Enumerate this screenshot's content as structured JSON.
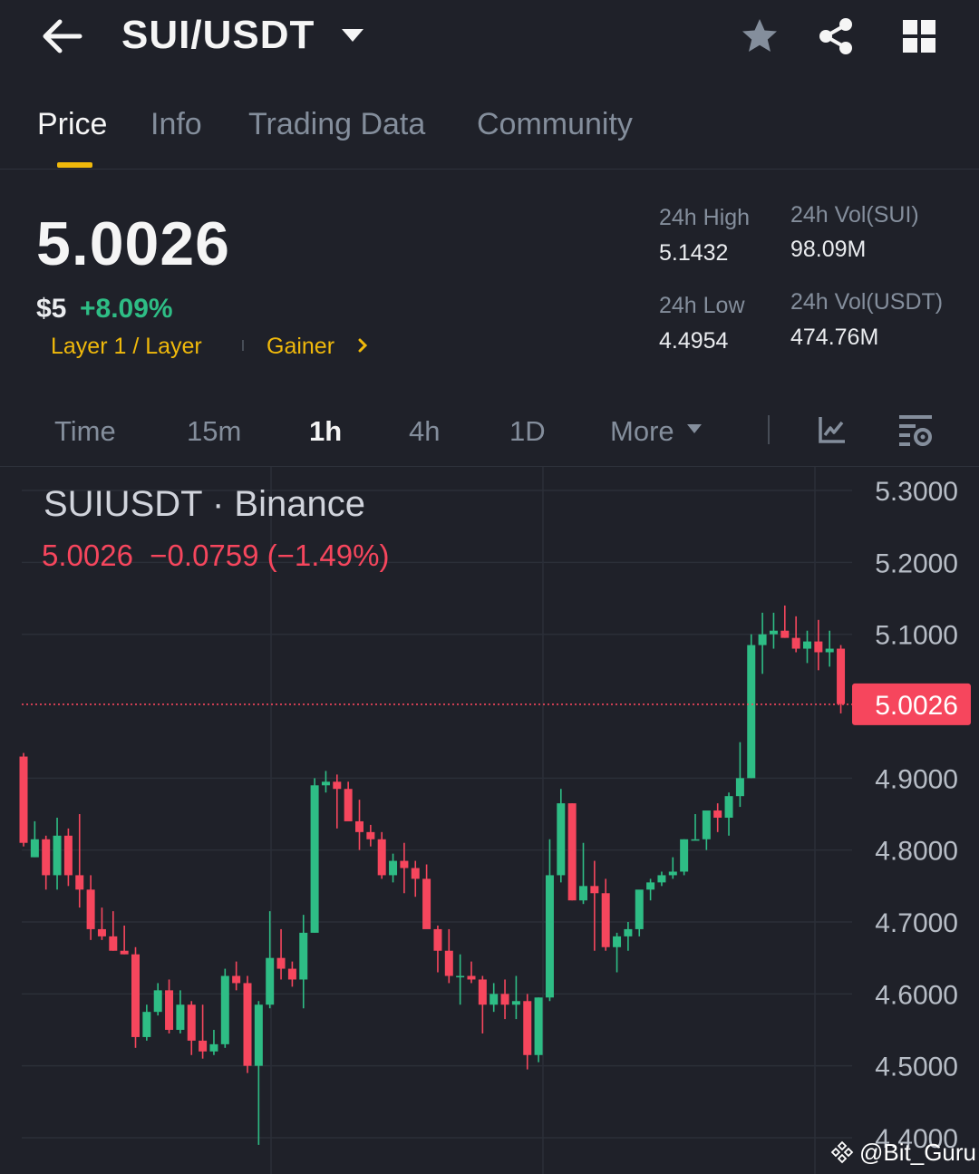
{
  "header": {
    "pair": "SUI/USDT",
    "icons": [
      "back-arrow-icon",
      "caret-down-icon",
      "star-icon",
      "share-icon",
      "grid-icon"
    ]
  },
  "tabs": [
    {
      "label": "Price",
      "active": true
    },
    {
      "label": "Info",
      "active": false
    },
    {
      "label": "Trading Data",
      "active": false
    },
    {
      "label": "Community",
      "active": false
    }
  ],
  "ticker": {
    "last_price": "5.0026",
    "usd_price": "$5",
    "change_pct": "+8.09%",
    "tag_category": "Layer 1 / Layer",
    "tag_gainer": "Gainer",
    "high_label": "24h High",
    "high_value": "5.1432",
    "low_label": "24h Low",
    "low_value": "4.4954",
    "vol_base_label": "24h Vol(SUI)",
    "vol_base_value": "98.09M",
    "vol_quote_label": "24h Vol(USDT)",
    "vol_quote_value": "474.76M"
  },
  "intervals": {
    "items": [
      "Time",
      "15m",
      "1h",
      "4h",
      "1D",
      "More"
    ],
    "selected": "1h"
  },
  "colors": {
    "up": "#2ebd85",
    "down": "#f6465d",
    "accent": "#f0b90b",
    "background": "#1f2129"
  },
  "chart_data": {
    "type": "candlestick",
    "symbol_title": "SUIUSDT · Binance",
    "ohlc_summary": "5.0026  −0.0759 (−1.49%)",
    "current_price_label": "5.0026",
    "current_price": 5.0026,
    "y_ticks": [
      "5.3000",
      "5.2000",
      "5.1000",
      "4.9000",
      "4.8000",
      "4.7000",
      "4.6000",
      "4.5000",
      "4.4000"
    ],
    "ylim": [
      4.37,
      5.305
    ],
    "grid": true,
    "candles": [
      {
        "o": 4.93,
        "h": 4.935,
        "l": 4.805,
        "c": 4.81
      },
      {
        "o": 4.79,
        "h": 4.84,
        "l": 4.79,
        "c": 4.815
      },
      {
        "o": 4.815,
        "h": 4.82,
        "l": 4.745,
        "c": 4.765
      },
      {
        "o": 4.765,
        "h": 4.845,
        "l": 4.745,
        "c": 4.82
      },
      {
        "o": 4.82,
        "h": 4.83,
        "l": 4.75,
        "c": 4.765
      },
      {
        "o": 4.765,
        "h": 4.85,
        "l": 4.72,
        "c": 4.745
      },
      {
        "o": 4.745,
        "h": 4.765,
        "l": 4.675,
        "c": 4.69
      },
      {
        "o": 4.69,
        "h": 4.72,
        "l": 4.675,
        "c": 4.68
      },
      {
        "o": 4.68,
        "h": 4.715,
        "l": 4.66,
        "c": 4.66
      },
      {
        "o": 4.66,
        "h": 4.695,
        "l": 4.655,
        "c": 4.655
      },
      {
        "o": 4.655,
        "h": 4.665,
        "l": 4.525,
        "c": 4.54
      },
      {
        "o": 4.54,
        "h": 4.585,
        "l": 4.535,
        "c": 4.575
      },
      {
        "o": 4.575,
        "h": 4.615,
        "l": 4.57,
        "c": 4.605
      },
      {
        "o": 4.605,
        "h": 4.62,
        "l": 4.545,
        "c": 4.55
      },
      {
        "o": 4.55,
        "h": 4.605,
        "l": 4.545,
        "c": 4.585
      },
      {
        "o": 4.585,
        "h": 4.59,
        "l": 4.515,
        "c": 4.535
      },
      {
        "o": 4.535,
        "h": 4.585,
        "l": 4.51,
        "c": 4.52
      },
      {
        "o": 4.52,
        "h": 4.55,
        "l": 4.515,
        "c": 4.53
      },
      {
        "o": 4.53,
        "h": 4.635,
        "l": 4.525,
        "c": 4.625
      },
      {
        "o": 4.625,
        "h": 4.645,
        "l": 4.605,
        "c": 4.615
      },
      {
        "o": 4.615,
        "h": 4.625,
        "l": 4.49,
        "c": 4.5
      },
      {
        "o": 4.5,
        "h": 4.59,
        "l": 4.39,
        "c": 4.585
      },
      {
        "o": 4.585,
        "h": 4.715,
        "l": 4.58,
        "c": 4.65
      },
      {
        "o": 4.65,
        "h": 4.69,
        "l": 4.62,
        "c": 4.635
      },
      {
        "o": 4.635,
        "h": 4.645,
        "l": 4.61,
        "c": 4.62
      },
      {
        "o": 4.62,
        "h": 4.71,
        "l": 4.58,
        "c": 4.685
      },
      {
        "o": 4.685,
        "h": 4.9,
        "l": 4.685,
        "c": 4.89
      },
      {
        "o": 4.89,
        "h": 4.91,
        "l": 4.88,
        "c": 4.895
      },
      {
        "o": 4.895,
        "h": 4.905,
        "l": 4.83,
        "c": 4.885
      },
      {
        "o": 4.885,
        "h": 4.895,
        "l": 4.85,
        "c": 4.84
      },
      {
        "o": 4.84,
        "h": 4.87,
        "l": 4.8,
        "c": 4.825
      },
      {
        "o": 4.825,
        "h": 4.835,
        "l": 4.805,
        "c": 4.815
      },
      {
        "o": 4.815,
        "h": 4.825,
        "l": 4.76,
        "c": 4.765
      },
      {
        "o": 4.765,
        "h": 4.795,
        "l": 4.755,
        "c": 4.785
      },
      {
        "o": 4.785,
        "h": 4.81,
        "l": 4.74,
        "c": 4.775
      },
      {
        "o": 4.775,
        "h": 4.785,
        "l": 4.735,
        "c": 4.76
      },
      {
        "o": 4.76,
        "h": 4.78,
        "l": 4.7,
        "c": 4.69
      },
      {
        "o": 4.69,
        "h": 4.695,
        "l": 4.63,
        "c": 4.66
      },
      {
        "o": 4.66,
        "h": 4.69,
        "l": 4.615,
        "c": 4.625
      },
      {
        "o": 4.625,
        "h": 4.655,
        "l": 4.585,
        "c": 4.625
      },
      {
        "o": 4.625,
        "h": 4.645,
        "l": 4.615,
        "c": 4.62
      },
      {
        "o": 4.62,
        "h": 4.625,
        "l": 4.545,
        "c": 4.585
      },
      {
        "o": 4.585,
        "h": 4.615,
        "l": 4.575,
        "c": 4.6
      },
      {
        "o": 4.6,
        "h": 4.62,
        "l": 4.565,
        "c": 4.585
      },
      {
        "o": 4.585,
        "h": 4.625,
        "l": 4.565,
        "c": 4.59
      },
      {
        "o": 4.59,
        "h": 4.6,
        "l": 4.495,
        "c": 4.515
      },
      {
        "o": 4.515,
        "h": 4.595,
        "l": 4.505,
        "c": 4.595
      },
      {
        "o": 4.595,
        "h": 4.815,
        "l": 4.59,
        "c": 4.765
      },
      {
        "o": 4.765,
        "h": 4.885,
        "l": 4.755,
        "c": 4.865
      },
      {
        "o": 4.865,
        "h": 4.865,
        "l": 4.73,
        "c": 4.73
      },
      {
        "o": 4.73,
        "h": 4.81,
        "l": 4.725,
        "c": 4.75
      },
      {
        "o": 4.75,
        "h": 4.785,
        "l": 4.66,
        "c": 4.74
      },
      {
        "o": 4.74,
        "h": 4.76,
        "l": 4.66,
        "c": 4.665
      },
      {
        "o": 4.665,
        "h": 4.685,
        "l": 4.63,
        "c": 4.68
      },
      {
        "o": 4.68,
        "h": 4.7,
        "l": 4.66,
        "c": 4.69
      },
      {
        "o": 4.69,
        "h": 4.735,
        "l": 4.68,
        "c": 4.745
      },
      {
        "o": 4.745,
        "h": 4.76,
        "l": 4.73,
        "c": 4.755
      },
      {
        "o": 4.755,
        "h": 4.77,
        "l": 4.75,
        "c": 4.765
      },
      {
        "o": 4.765,
        "h": 4.79,
        "l": 4.76,
        "c": 4.77
      },
      {
        "o": 4.77,
        "h": 4.815,
        "l": 4.765,
        "c": 4.815
      },
      {
        "o": 4.815,
        "h": 4.85,
        "l": 4.815,
        "c": 4.815
      },
      {
        "o": 4.815,
        "h": 4.85,
        "l": 4.8,
        "c": 4.855
      },
      {
        "o": 4.855,
        "h": 4.865,
        "l": 4.825,
        "c": 4.845
      },
      {
        "o": 4.845,
        "h": 4.88,
        "l": 4.82,
        "c": 4.875
      },
      {
        "o": 4.875,
        "h": 4.95,
        "l": 4.86,
        "c": 4.9
      },
      {
        "o": 4.9,
        "h": 5.1,
        "l": 4.9,
        "c": 5.085
      },
      {
        "o": 5.085,
        "h": 5.13,
        "l": 5.045,
        "c": 5.1
      },
      {
        "o": 5.1,
        "h": 5.13,
        "l": 5.08,
        "c": 5.105
      },
      {
        "o": 5.105,
        "h": 5.14,
        "l": 5.095,
        "c": 5.095
      },
      {
        "o": 5.095,
        "h": 5.125,
        "l": 5.075,
        "c": 5.08
      },
      {
        "o": 5.08,
        "h": 5.105,
        "l": 5.06,
        "c": 5.09
      },
      {
        "o": 5.09,
        "h": 5.12,
        "l": 5.05,
        "c": 5.075
      },
      {
        "o": 5.075,
        "h": 5.105,
        "l": 5.055,
        "c": 5.08
      },
      {
        "o": 5.08,
        "h": 5.085,
        "l": 4.99,
        "c": 5.003
      }
    ]
  },
  "watermark": "@Bit_Guru"
}
